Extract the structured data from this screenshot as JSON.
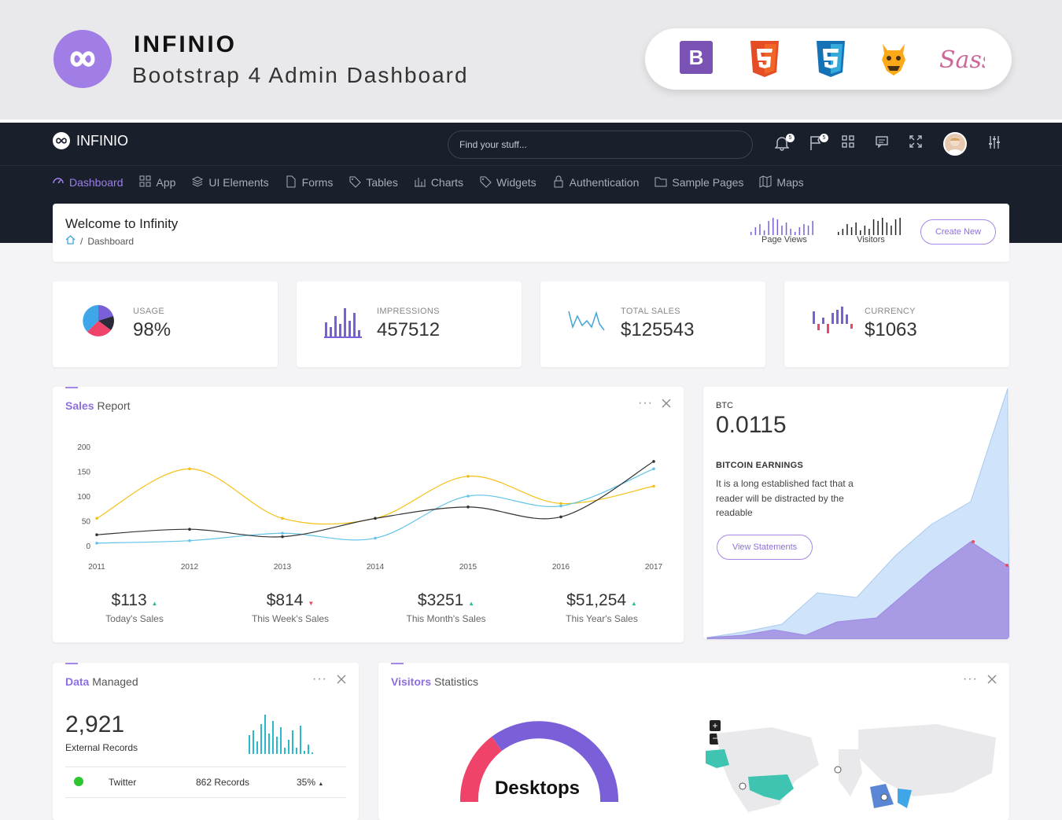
{
  "banner": {
    "title": "INFINIO",
    "subtitle": "Bootstrap 4 Admin Dashboard",
    "tech_icons": [
      "bootstrap-icon",
      "html5-icon",
      "css3-icon",
      "grunt-icon",
      "sass-icon"
    ],
    "bootstrap_letter": "B",
    "sass_text": "Sass"
  },
  "topbar": {
    "brand": "INFINIO",
    "search_placeholder": "Find your stuff...",
    "notif_count": "5",
    "flag_count": "5"
  },
  "nav": [
    {
      "label": "Dashboard",
      "icon": "dashboard-icon",
      "active": true
    },
    {
      "label": "App",
      "icon": "grid-icon"
    },
    {
      "label": "UI Elements",
      "icon": "layers-icon"
    },
    {
      "label": "Forms",
      "icon": "file-icon"
    },
    {
      "label": "Tables",
      "icon": "tag-icon"
    },
    {
      "label": "Charts",
      "icon": "bar-chart-icon"
    },
    {
      "label": "Widgets",
      "icon": "tag-icon"
    },
    {
      "label": "Authentication",
      "icon": "lock-icon"
    },
    {
      "label": "Sample Pages",
      "icon": "folder-icon"
    },
    {
      "label": "Maps",
      "icon": "map-icon"
    }
  ],
  "welcome": {
    "title": "Welcome to Infinity",
    "crumb": "Dashboard",
    "sparks": [
      {
        "label": "Page Views"
      },
      {
        "label": "Visitors"
      }
    ],
    "create_label": "Create New"
  },
  "stats": [
    {
      "label": "USAGE",
      "value": "98%"
    },
    {
      "label": "IMPRESSIONS",
      "value": "457512"
    },
    {
      "label": "TOTAL SALES",
      "value": "$125543"
    },
    {
      "label": "CURRENCY",
      "value": "$1063"
    }
  ],
  "sales": {
    "title_bold": "Sales",
    "title_rest": " Report",
    "totals": [
      {
        "value": "$113",
        "label": "Today's Sales",
        "trend": "up"
      },
      {
        "value": "$814",
        "label": "This Week's Sales",
        "trend": "down"
      },
      {
        "value": "$3251",
        "label": "This Month's Sales",
        "trend": "up"
      },
      {
        "value": "$51,254",
        "label": "This Year's Sales",
        "trend": "up"
      }
    ]
  },
  "btc": {
    "label": "BTC",
    "value": "0.0115",
    "heading": "BITCOIN EARNINGS",
    "text": "It is a long established fact that a reader will be distracted by the readable",
    "button": "View Statements"
  },
  "data_managed": {
    "title_bold": "Data",
    "title_rest": " Managed",
    "value": "2,921",
    "sub": "External Records",
    "row": {
      "name": "Twitter",
      "records": "862 Records",
      "pct": "35%"
    }
  },
  "visitors": {
    "title_bold": "Visitors",
    "title_rest": " Statistics",
    "donut_label": "Desktops"
  },
  "chart_data": {
    "type": "line",
    "x": [
      2011,
      2012,
      2013,
      2014,
      2015,
      2016,
      2017
    ],
    "ylim": [
      0,
      200
    ],
    "yticks": [
      0,
      50,
      100,
      150,
      200
    ],
    "series": [
      {
        "color": "#f5c016",
        "values": [
          55,
          155,
          55,
          55,
          140,
          85,
          120
        ]
      },
      {
        "color": "#63c3e8",
        "values": [
          5,
          10,
          25,
          15,
          100,
          80,
          155
        ]
      },
      {
        "color": "#333333",
        "values": [
          22,
          33,
          18,
          55,
          78,
          58,
          170
        ]
      }
    ]
  },
  "colors": {
    "accent": "#8e6fe0",
    "dark": "#1a1f2c",
    "green": "#2bc48a",
    "red": "#f04a5b"
  }
}
